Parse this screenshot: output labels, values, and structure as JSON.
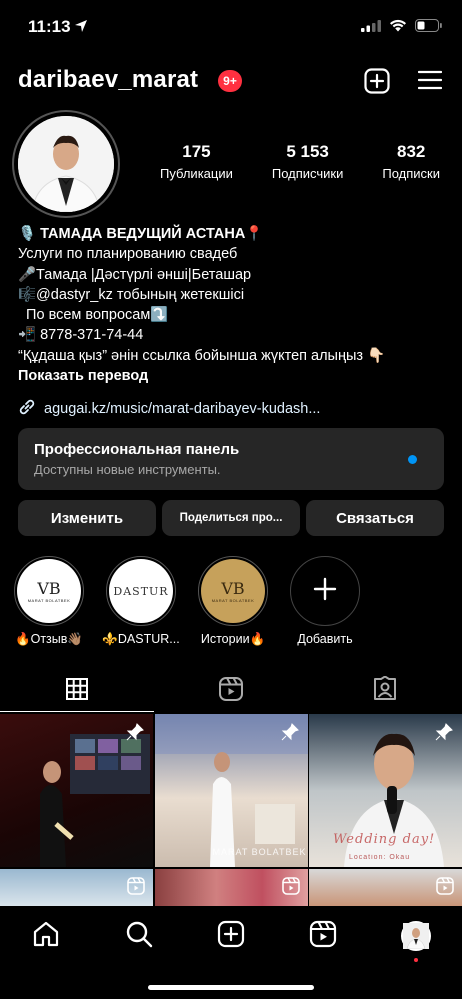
{
  "status_bar": {
    "time": "11:13"
  },
  "header": {
    "username": "daribaev_marat",
    "notifications_badge": "9+"
  },
  "stats": [
    {
      "value": "175",
      "label": "Публикации"
    },
    {
      "value": "5 153",
      "label": "Подписчики"
    },
    {
      "value": "832",
      "label": "Подписки"
    }
  ],
  "bio": {
    "name": "🎙️ ТАМАДА ВЕДУЩИЙ АСТАНА📍",
    "category": "Услуги по планированию свадеб",
    "lines": [
      "🎤Тамада |Дәстүрлі әнші|Беташар",
      "🎼@dastyr_kz  тобының жетекшісі",
      "  По всем вопросам⤵️",
      "📲 8778-371-74-44",
      "“Құдаша қыз” әнін ссылка бойынша жүктеп алыңыз 👇🏻"
    ],
    "translate": "Показать перевод",
    "link": "agugai.kz/music/marat-daribayev-kudash..."
  },
  "pro_panel": {
    "title": "Профессиональная панель",
    "subtitle": "Доступны новые инструменты."
  },
  "buttons": {
    "edit": "Изменить",
    "share": "Поделиться про...",
    "contact": "Связаться"
  },
  "highlights": [
    {
      "label": "🔥Отзыв👋🏽",
      "logo": "VB",
      "logo_sub": "MARAT BOLATBEK"
    },
    {
      "label": "⚜️DASTUR...",
      "logo": "DASTUR"
    },
    {
      "label": "Истории🔥",
      "logo": "VB",
      "logo_sub": "MARAT BOLATBEK"
    },
    {
      "label": "Добавить"
    }
  ],
  "grid": {
    "watermark": "MARAT BOLATBEK",
    "wedding_text": "Wedding day!",
    "location_text": "Location: Okau"
  },
  "colors": {
    "accent": "#0095f6",
    "badge": "#ff3040",
    "panel": "#262626"
  }
}
